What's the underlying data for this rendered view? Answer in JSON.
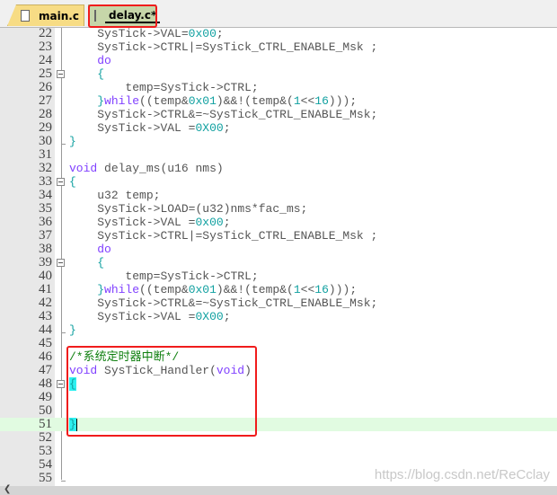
{
  "tabs": [
    {
      "label": "main.c",
      "active": false
    },
    {
      "label": "delay.c*",
      "active": true
    }
  ],
  "editor": {
    "first_line": 22,
    "current_line": 51,
    "lines": [
      "    SysTick->VAL=0x00;",
      "    SysTick->CTRL|=SysTick_CTRL_ENABLE_Msk ;",
      "    do",
      "    {",
      "        temp=SysTick->CTRL;",
      "    }while((temp&0x01)&&!(temp&(1<<16)));",
      "    SysTick->CTRL&=~SysTick_CTRL_ENABLE_Msk;",
      "    SysTick->VAL =0X00;",
      "}",
      "",
      "void delay_ms(u16 nms)",
      "{",
      "    u32 temp;",
      "    SysTick->LOAD=(u32)nms*fac_ms;",
      "    SysTick->VAL =0x00;",
      "    SysTick->CTRL|=SysTick_CTRL_ENABLE_Msk ;",
      "    do",
      "    {",
      "        temp=SysTick->CTRL;",
      "    }while((temp&0x01)&&!(temp&(1<<16)));",
      "    SysTick->CTRL&=~SysTick_CTRL_ENABLE_Msk;",
      "    SysTick->VAL =0X00;",
      "}",
      "",
      "/*系统定时器中断*/",
      "void SysTick_Handler(void)",
      "{",
      "",
      "",
      "}",
      "",
      "",
      "",
      ""
    ],
    "fold_open_lines": [
      25,
      33,
      39,
      48
    ],
    "fold_end_lines": [
      30,
      44,
      55
    ],
    "keywords": [
      "do",
      "while",
      "void"
    ]
  },
  "watermark": "https://blog.csdn.net/ReCclay",
  "colors": {
    "highlight_box": "#f01c1c",
    "current_line": "#e1fbe1",
    "brace_match": "#2ef0f0"
  }
}
